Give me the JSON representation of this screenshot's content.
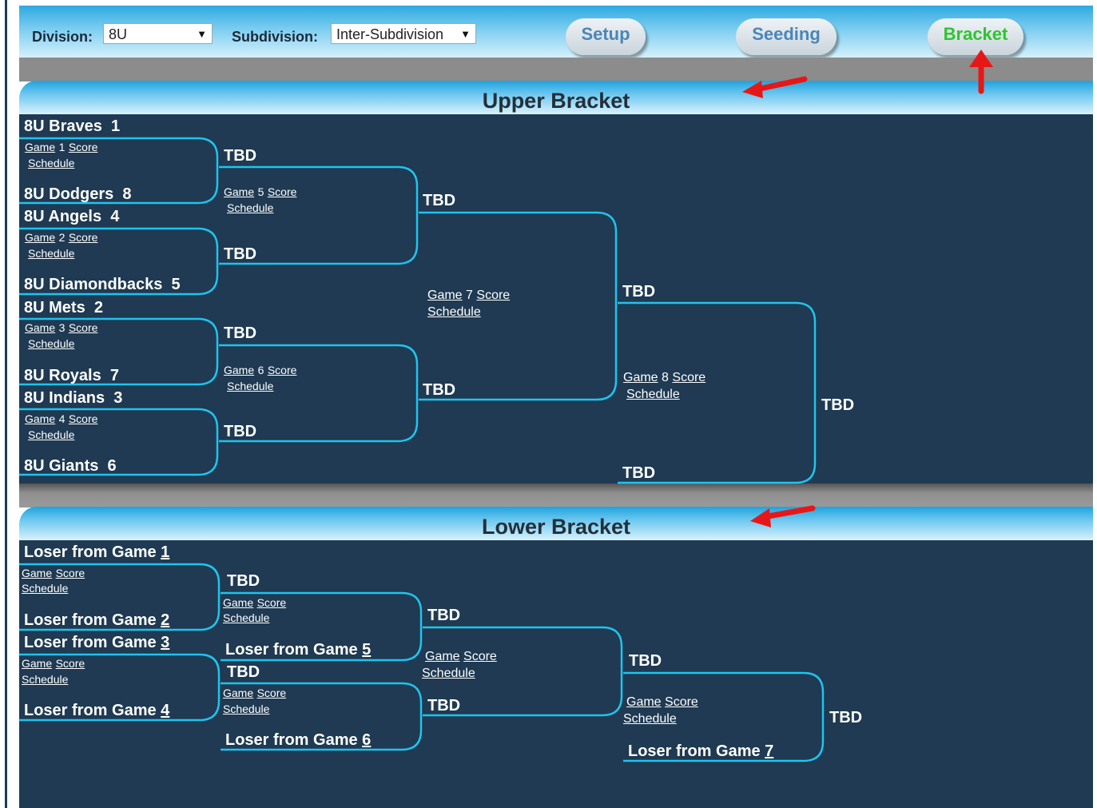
{
  "toolbar": {
    "division_label": "Division:",
    "division_value": "8U",
    "subdivision_label": "Subdivision:",
    "subdivision_value": "Inter-Subdivision",
    "buttons": [
      "Setup",
      "Seeding",
      "Bracket"
    ],
    "colors": {
      "inactive": "#4a86b8",
      "active": "#2ec52e",
      "annotation": "#e81717"
    }
  },
  "upper": {
    "title": "Upper Bracket",
    "teams": [
      {
        "name": "8U Braves",
        "seed": "1"
      },
      {
        "name": "8U Dodgers",
        "seed": "8"
      },
      {
        "name": "8U Angels",
        "seed": "4"
      },
      {
        "name": "8U Diamondbacks",
        "seed": "5"
      },
      {
        "name": "8U Mets",
        "seed": "2"
      },
      {
        "name": "8U Royals",
        "seed": "7"
      },
      {
        "name": "8U Indians",
        "seed": "3"
      },
      {
        "name": "8U Giants",
        "seed": "6"
      }
    ],
    "games": [
      "1",
      "2",
      "3",
      "4",
      "5",
      "6",
      "7",
      "8"
    ],
    "game_word": "Game",
    "score_word": "Score",
    "schedule_word": "Schedule",
    "tbd": "TBD"
  },
  "lower": {
    "title": "Lower Bracket",
    "loser_prefix": "Loser from Game",
    "losers": [
      "1",
      "2",
      "3",
      "4",
      "5",
      "6",
      "7"
    ],
    "game_word": "Game",
    "score_word": "Score",
    "schedule_word": "Schedule",
    "tbd": "TBD"
  }
}
